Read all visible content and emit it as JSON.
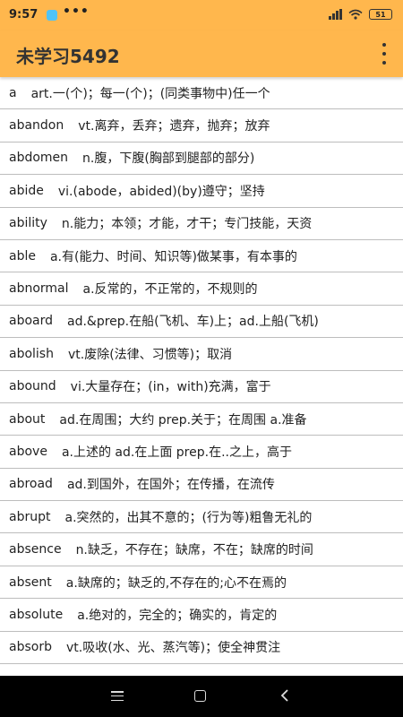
{
  "status_bar": {
    "time": "9:57",
    "notification_icons": "•••",
    "battery_level": "51"
  },
  "app_bar": {
    "title": "未学习5492",
    "menu_icon": "more-vert-icon"
  },
  "colors": {
    "app_bar": "#ffb74d",
    "divider": "#bdbdbd",
    "nav_bar": "#000000"
  },
  "words": [
    {
      "word": "a",
      "definition": "art.一(个)；每一(个)；(同类事物中)任一个"
    },
    {
      "word": "abandon",
      "definition": "vt.离弃，丢弃；遗弃，抛弃；放弃"
    },
    {
      "word": "abdomen",
      "definition": "n.腹，下腹(胸部到腿部的部分)"
    },
    {
      "word": "abide",
      "definition": "vi.(abode，abided)(by)遵守；坚持"
    },
    {
      "word": "ability",
      "definition": "n.能力；本领；才能，才干；专门技能，天资"
    },
    {
      "word": "able",
      "definition": "a.有(能力、时间、知识等)做某事，有本事的"
    },
    {
      "word": "abnormal",
      "definition": "a.反常的，不正常的，不规则的"
    },
    {
      "word": "aboard",
      "definition": "ad.&prep.在船(飞机、车)上；ad.上船(飞机)"
    },
    {
      "word": "abolish",
      "definition": "vt.废除(法律、习惯等)；取消"
    },
    {
      "word": "abound",
      "definition": "vi.大量存在；(in，with)充满，富于"
    },
    {
      "word": "about",
      "definition": "ad.在周围；大约 prep.关于；在周围 a.准备"
    },
    {
      "word": "above",
      "definition": "a.上述的 ad.在上面  prep.在..之上，高于"
    },
    {
      "word": "abroad",
      "definition": "ad.到国外，在国外；在传播，在流传"
    },
    {
      "word": "abrupt",
      "definition": "a.突然的，出其不意的；(行为等)粗鲁无礼的"
    },
    {
      "word": "absence",
      "definition": "n.缺乏，不存在；缺席，不在；缺席的时间"
    },
    {
      "word": "absent",
      "definition": "a.缺席的；缺乏的,不存在的;心不在焉的"
    },
    {
      "word": "absolute",
      "definition": "a.绝对的，完全的；确实的，肯定的"
    },
    {
      "word": "absorb",
      "definition": "vt.吸收(水、光、蒸汽等)；使全神贯注"
    }
  ],
  "nav_bar": {
    "menu_icon": "menu-icon",
    "home_icon": "home-icon",
    "back_icon": "back-icon"
  }
}
